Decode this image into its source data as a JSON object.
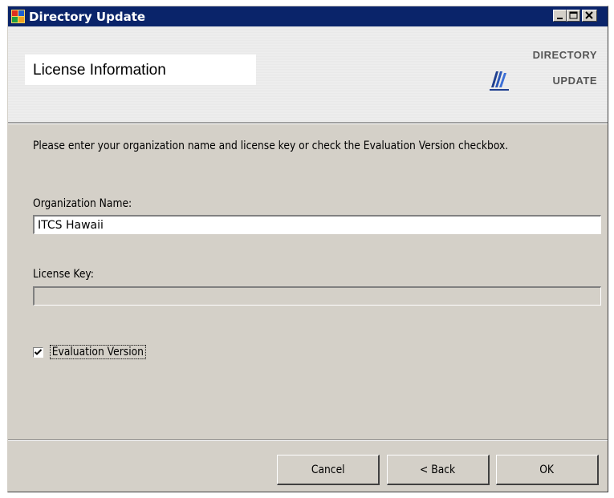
{
  "window": {
    "title": "Directory Update"
  },
  "header": {
    "title": "License Information",
    "logo_line1": "Directory",
    "logo_line2": "Update"
  },
  "form": {
    "instructions": "Please enter your organization name and license key or check the Evaluation Version checkbox.",
    "org_label": "Organization Name:",
    "org_value": "ITCS Hawaii",
    "license_label": "License Key:",
    "license_value": "",
    "evaluation_label": "Evaluation Version",
    "evaluation_checked": true
  },
  "buttons": {
    "cancel": "Cancel",
    "back": "< Back",
    "ok": "OK"
  },
  "colors": {
    "titlebar": "#0a246a",
    "dialog_face": "#d4d0c8"
  }
}
